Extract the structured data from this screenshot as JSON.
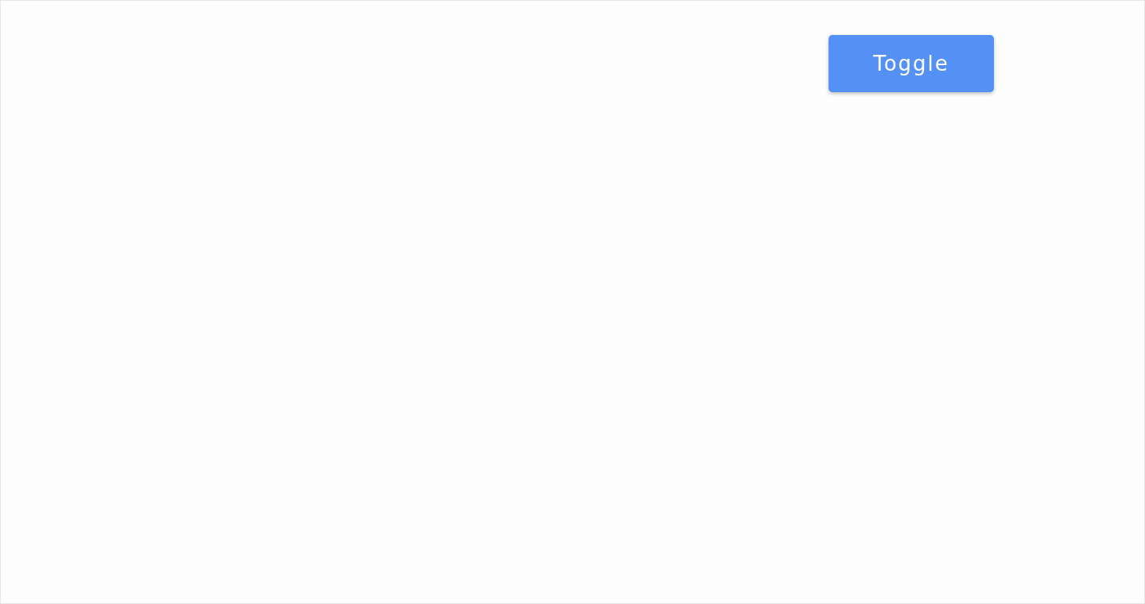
{
  "toggle_button": {
    "label": "Toggle"
  }
}
